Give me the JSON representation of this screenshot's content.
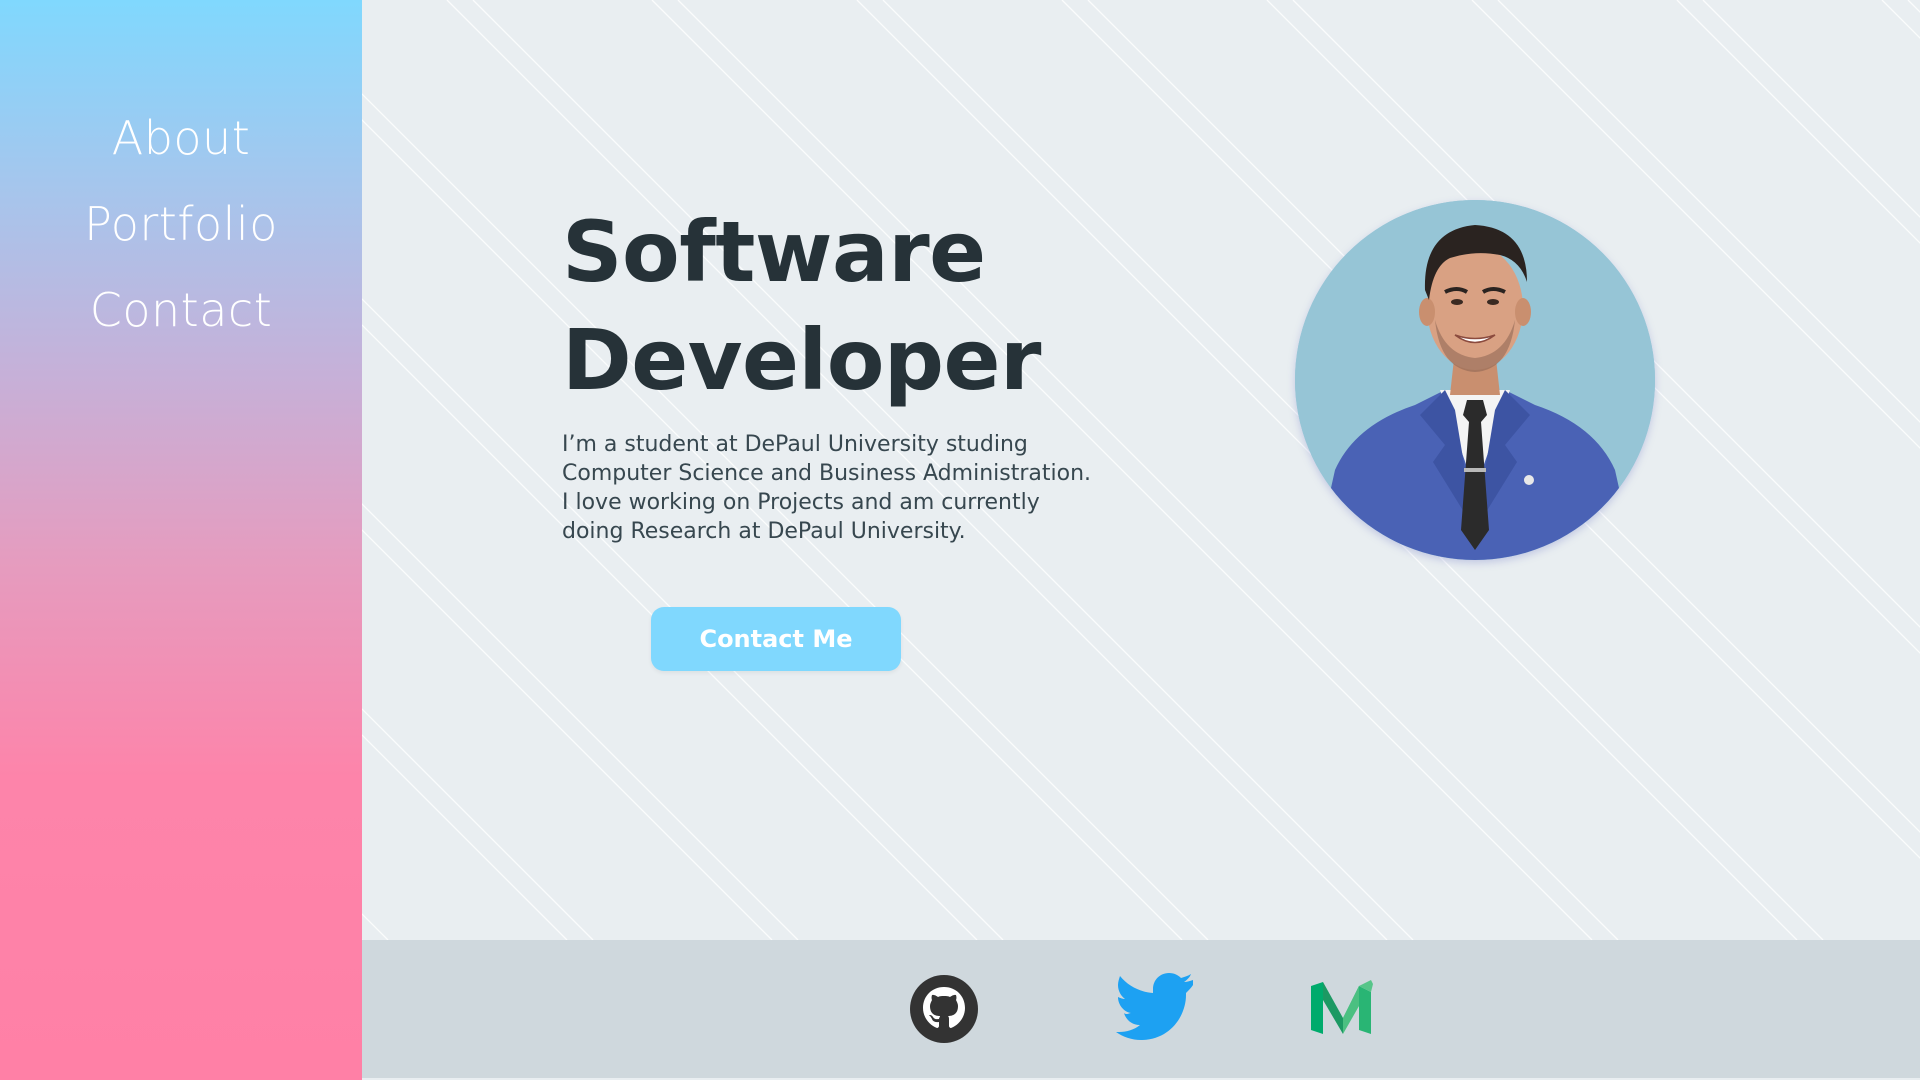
{
  "sidebar": {
    "nav": [
      {
        "label": "About"
      },
      {
        "label": "Portfolio"
      },
      {
        "label": "Contact"
      }
    ]
  },
  "hero": {
    "headline_line1": "Software",
    "headline_line2": "Developer",
    "bio_lines": [
      "I’m a student at DePaul University studing",
      "Computer Science and Business Administration.",
      "I love working on Projects and am currently",
      "doing Research at DePaul University."
    ],
    "cta_label": "Contact Me"
  },
  "footer": {
    "social": [
      {
        "icon": "github-icon"
      },
      {
        "icon": "twitter-icon"
      },
      {
        "icon": "medium-icon"
      }
    ]
  },
  "colors": {
    "sidebar_top": "#80d8fe",
    "sidebar_bottom": "#ff80a6",
    "background": "#e9eef1",
    "headline": "#263238",
    "button": "#80d8fe",
    "footer": "#cfd8dd",
    "twitter": "#1da1f2",
    "github": "#333333"
  }
}
